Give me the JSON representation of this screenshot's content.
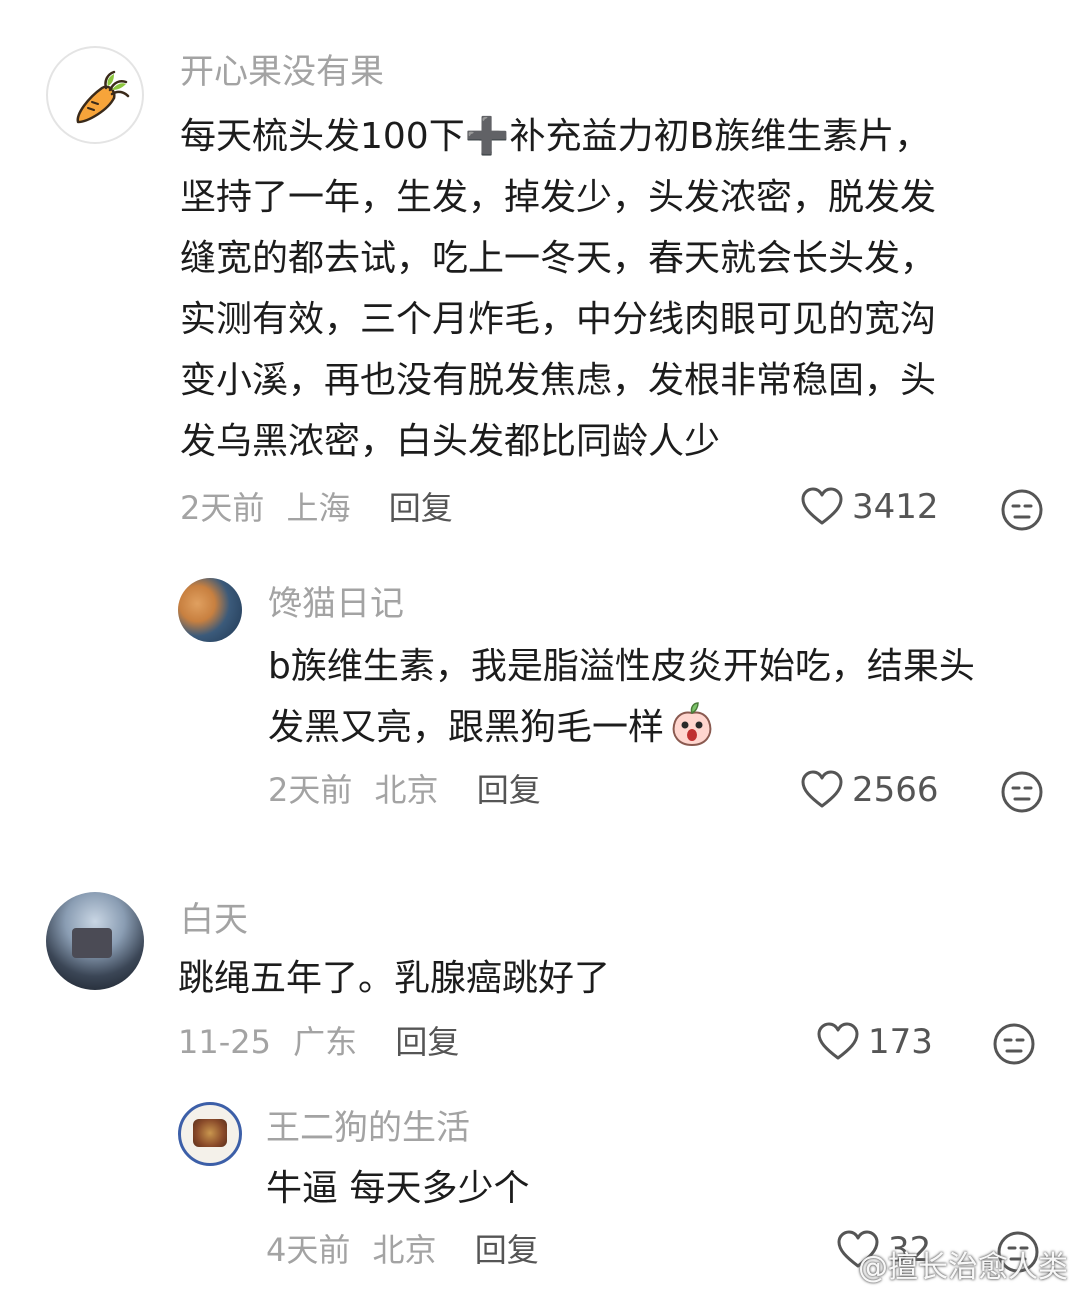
{
  "comments": [
    {
      "username": "开心果没有果",
      "body_lines": [
        "每天梳头发100下➕补充益力初B族维生素片，",
        "坚持了一年，生发，掉发少，头发浓密，脱发发",
        "缝宽的都去试，吃上一冬天，春天就会长头发，",
        "实测有效，三个月炸毛，中分线肉眼可见的宽沟",
        "变小溪，再也没有脱发焦虑，发根非常稳固，头",
        "发乌黑浓密，白头发都比同龄人少"
      ],
      "time": "2天前",
      "location": "上海",
      "reply_label": "回复",
      "likes": "3412",
      "avatar_icon": "carrot-icon"
    },
    {
      "username": "馋猫日记",
      "body_lines": [
        "b族维生素，我是脂溢性皮炎开始吃，结果头",
        "发黑又亮，跟黑狗毛一样"
      ],
      "time": "2天前",
      "location": "北京",
      "reply_label": "回复",
      "likes": "2566",
      "trailing_emoji": "peach-shocked-emoji"
    },
    {
      "username": "白天",
      "body_lines": [
        "跳绳五年了。乳腺癌跳好了"
      ],
      "time": "11-25",
      "location": "广东",
      "reply_label": "回复",
      "likes": "173"
    },
    {
      "username": "王二狗的生活",
      "body_lines": [
        "牛逼 每天多少个"
      ],
      "time": "4天前",
      "location": "北京",
      "reply_label": "回复",
      "likes": "32"
    }
  ],
  "watermark": "@擅长治愈人类",
  "colors": {
    "text": "#1c1c1c",
    "muted": "#a3a3a3",
    "icon": "#555555"
  }
}
